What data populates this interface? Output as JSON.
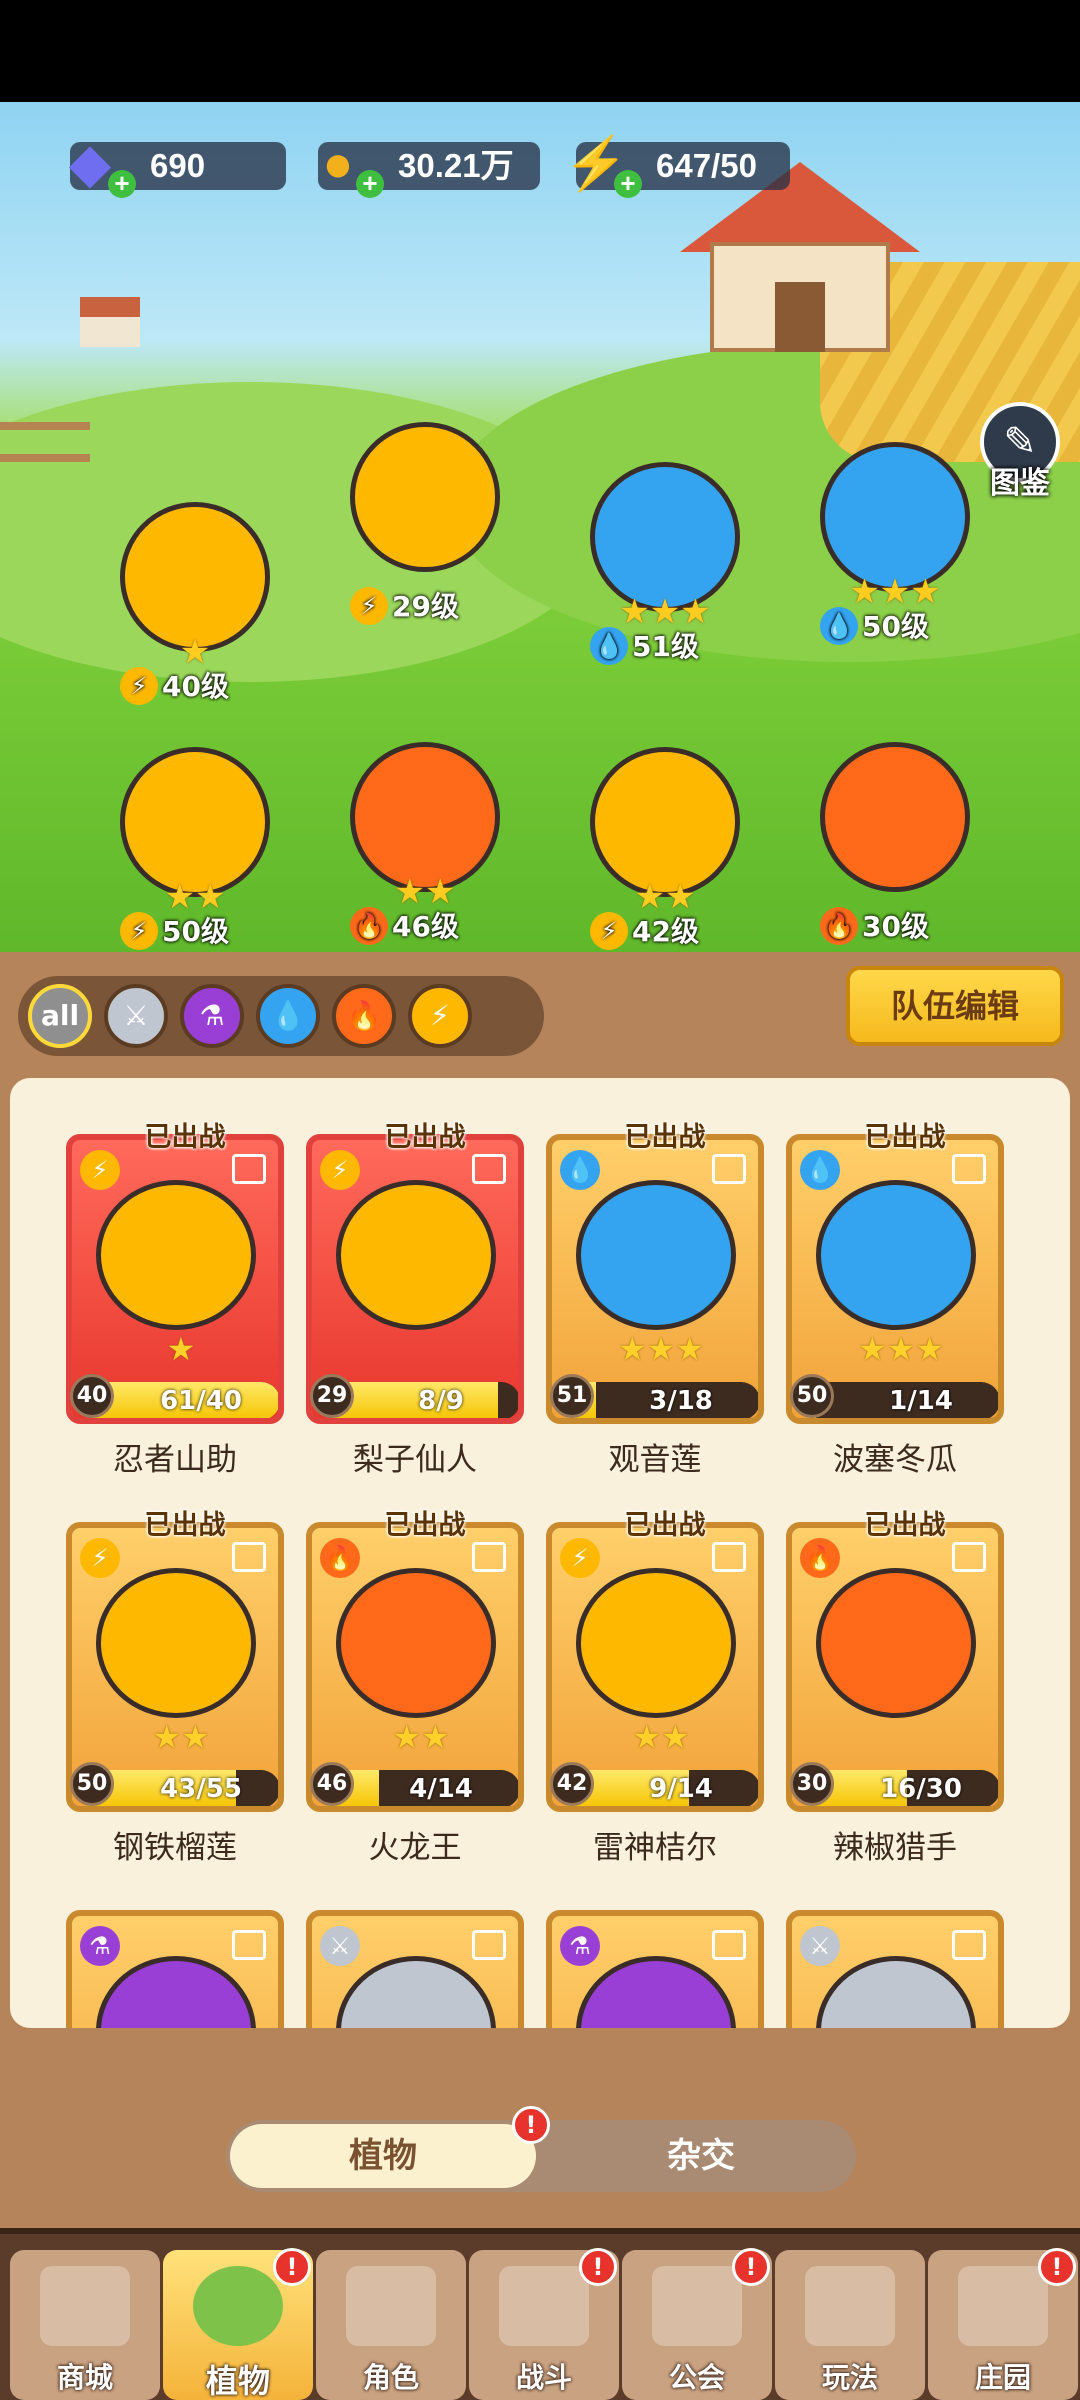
{
  "resources": {
    "gems": "690",
    "gold": "30.21万",
    "energy": "647/50"
  },
  "codex_label": "图鉴",
  "lineup": [
    {
      "level": "40级",
      "element": "thunder",
      "stars": "★"
    },
    {
      "level": "29级",
      "element": "thunder",
      "stars": ""
    },
    {
      "level": "51级",
      "element": "water",
      "stars": "★★★"
    },
    {
      "level": "50级",
      "element": "water",
      "stars": "★★★"
    },
    {
      "level": "50级",
      "element": "thunder",
      "stars": "★★"
    },
    {
      "level": "46级",
      "element": "fire",
      "stars": "★★"
    },
    {
      "level": "42级",
      "element": "thunder",
      "stars": "★★"
    },
    {
      "level": "30级",
      "element": "fire",
      "stars": ""
    }
  ],
  "filters": [
    "all",
    "sword",
    "poison",
    "water",
    "fire",
    "thunder"
  ],
  "team_edit_label": "队伍编辑",
  "deployed_tag": "已出战",
  "cards": [
    {
      "name": "忍者山助",
      "level": "40",
      "progress": "61/40",
      "fill": 1.0,
      "element": "thunder",
      "stars": "★",
      "style": "red"
    },
    {
      "name": "梨子仙人",
      "level": "29",
      "progress": "8/9",
      "fill": 0.89,
      "element": "thunder",
      "stars": "",
      "style": "red"
    },
    {
      "name": "观音莲",
      "level": "51",
      "progress": "3/18",
      "fill": 0.17,
      "element": "water",
      "stars": "★★★",
      "style": "gold"
    },
    {
      "name": "波塞冬瓜",
      "level": "50",
      "progress": "1/14",
      "fill": 0.07,
      "element": "water",
      "stars": "★★★",
      "style": "gold"
    },
    {
      "name": "钢铁榴莲",
      "level": "50",
      "progress": "43/55",
      "fill": 0.78,
      "element": "thunder",
      "stars": "★★",
      "style": "gold"
    },
    {
      "name": "火龙王",
      "level": "46",
      "progress": "4/14",
      "fill": 0.29,
      "element": "fire",
      "stars": "★★",
      "style": "gold"
    },
    {
      "name": "雷神桔尔",
      "level": "42",
      "progress": "9/14",
      "fill": 0.64,
      "element": "thunder",
      "stars": "★★",
      "style": "gold"
    },
    {
      "name": "辣椒猎手",
      "level": "30",
      "progress": "16/30",
      "fill": 0.53,
      "element": "fire",
      "stars": "",
      "style": "gold"
    },
    {
      "name": "",
      "level": "",
      "progress": "",
      "fill": 0,
      "element": "poison",
      "stars": "",
      "style": "gold"
    },
    {
      "name": "",
      "level": "",
      "progress": "",
      "fill": 0,
      "element": "sword",
      "stars": "",
      "style": "gold"
    },
    {
      "name": "",
      "level": "",
      "progress": "",
      "fill": 0,
      "element": "poison",
      "stars": "",
      "style": "gold"
    },
    {
      "name": "",
      "level": "",
      "progress": "",
      "fill": 0,
      "element": "sword",
      "stars": "",
      "style": "gold"
    }
  ],
  "segment": {
    "active": "植物",
    "inactive": "杂交"
  },
  "nav": [
    {
      "label": "商城",
      "badge": false
    },
    {
      "label": "植物",
      "badge": true,
      "active": true
    },
    {
      "label": "角色",
      "badge": false
    },
    {
      "label": "战斗",
      "badge": true
    },
    {
      "label": "公会",
      "badge": true
    },
    {
      "label": "玩法",
      "badge": false
    },
    {
      "label": "庄园",
      "badge": true
    }
  ],
  "badge_mark": "!",
  "colors": {
    "thunder": "#ffb800",
    "water": "#34a4f0",
    "fire": "#ff6a1a",
    "poison": "#9a3fd6",
    "sword": "#bfc6cf"
  }
}
